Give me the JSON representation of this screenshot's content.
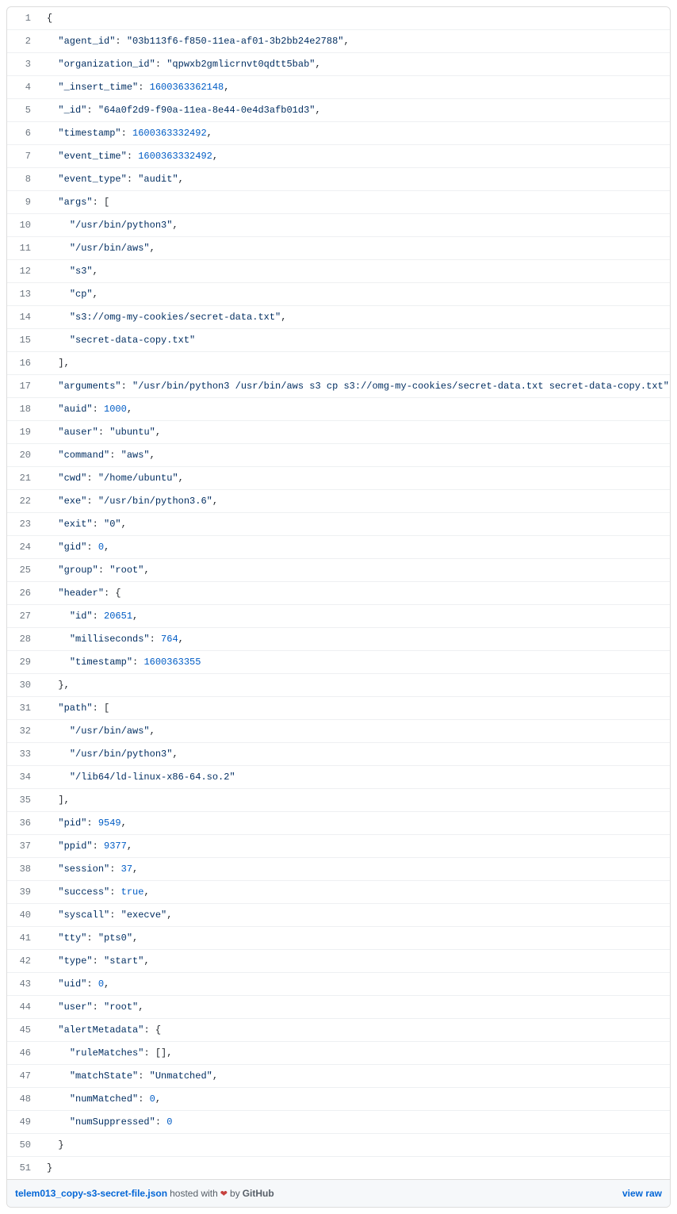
{
  "lines": [
    {
      "num": 1,
      "tokens": [
        {
          "t": "punct",
          "v": "{"
        }
      ],
      "indent": 0
    },
    {
      "num": 2,
      "tokens": [
        {
          "t": "key",
          "v": "\"agent_id\""
        },
        {
          "t": "punct",
          "v": ": "
        },
        {
          "t": "str",
          "v": "\"03b113f6-f850-11ea-af01-3b2bb24e2788\""
        },
        {
          "t": "punct",
          "v": ","
        }
      ],
      "indent": 1
    },
    {
      "num": 3,
      "tokens": [
        {
          "t": "key",
          "v": "\"organization_id\""
        },
        {
          "t": "punct",
          "v": ": "
        },
        {
          "t": "str",
          "v": "\"qpwxb2gmlicrnvt0qdtt5bab\""
        },
        {
          "t": "punct",
          "v": ","
        }
      ],
      "indent": 1
    },
    {
      "num": 4,
      "tokens": [
        {
          "t": "key",
          "v": "\"_insert_time\""
        },
        {
          "t": "punct",
          "v": ": "
        },
        {
          "t": "num",
          "v": "1600363362148"
        },
        {
          "t": "punct",
          "v": ","
        }
      ],
      "indent": 1
    },
    {
      "num": 5,
      "tokens": [
        {
          "t": "key",
          "v": "\"_id\""
        },
        {
          "t": "punct",
          "v": ": "
        },
        {
          "t": "str",
          "v": "\"64a0f2d9-f90a-11ea-8e44-0e4d3afb01d3\""
        },
        {
          "t": "punct",
          "v": ","
        }
      ],
      "indent": 1
    },
    {
      "num": 6,
      "tokens": [
        {
          "t": "key",
          "v": "\"timestamp\""
        },
        {
          "t": "punct",
          "v": ": "
        },
        {
          "t": "num",
          "v": "1600363332492"
        },
        {
          "t": "punct",
          "v": ","
        }
      ],
      "indent": 1
    },
    {
      "num": 7,
      "tokens": [
        {
          "t": "key",
          "v": "\"event_time\""
        },
        {
          "t": "punct",
          "v": ": "
        },
        {
          "t": "num",
          "v": "1600363332492"
        },
        {
          "t": "punct",
          "v": ","
        }
      ],
      "indent": 1
    },
    {
      "num": 8,
      "tokens": [
        {
          "t": "key",
          "v": "\"event_type\""
        },
        {
          "t": "punct",
          "v": ": "
        },
        {
          "t": "str",
          "v": "\"audit\""
        },
        {
          "t": "punct",
          "v": ","
        }
      ],
      "indent": 1
    },
    {
      "num": 9,
      "tokens": [
        {
          "t": "key",
          "v": "\"args\""
        },
        {
          "t": "punct",
          "v": ": ["
        }
      ],
      "indent": 1
    },
    {
      "num": 10,
      "tokens": [
        {
          "t": "str",
          "v": "\"/usr/bin/python3\""
        },
        {
          "t": "punct",
          "v": ","
        }
      ],
      "indent": 2
    },
    {
      "num": 11,
      "tokens": [
        {
          "t": "str",
          "v": "\"/usr/bin/aws\""
        },
        {
          "t": "punct",
          "v": ","
        }
      ],
      "indent": 2
    },
    {
      "num": 12,
      "tokens": [
        {
          "t": "str",
          "v": "\"s3\""
        },
        {
          "t": "punct",
          "v": ","
        }
      ],
      "indent": 2
    },
    {
      "num": 13,
      "tokens": [
        {
          "t": "str",
          "v": "\"cp\""
        },
        {
          "t": "punct",
          "v": ","
        }
      ],
      "indent": 2
    },
    {
      "num": 14,
      "tokens": [
        {
          "t": "str",
          "v": "\"s3://omg-my-cookies/secret-data.txt\""
        },
        {
          "t": "punct",
          "v": ","
        }
      ],
      "indent": 2
    },
    {
      "num": 15,
      "tokens": [
        {
          "t": "str",
          "v": "\"secret-data-copy.txt\""
        }
      ],
      "indent": 2
    },
    {
      "num": 16,
      "tokens": [
        {
          "t": "punct",
          "v": "],"
        }
      ],
      "indent": 1
    },
    {
      "num": 17,
      "tokens": [
        {
          "t": "key",
          "v": "\"arguments\""
        },
        {
          "t": "punct",
          "v": ": "
        },
        {
          "t": "str",
          "v": "\"/usr/bin/python3 /usr/bin/aws s3 cp s3://omg-my-cookies/secret-data.txt secret-data-copy.txt\""
        },
        {
          "t": "punct",
          "v": ","
        }
      ],
      "indent": 1
    },
    {
      "num": 18,
      "tokens": [
        {
          "t": "key",
          "v": "\"auid\""
        },
        {
          "t": "punct",
          "v": ": "
        },
        {
          "t": "num",
          "v": "1000"
        },
        {
          "t": "punct",
          "v": ","
        }
      ],
      "indent": 1
    },
    {
      "num": 19,
      "tokens": [
        {
          "t": "key",
          "v": "\"auser\""
        },
        {
          "t": "punct",
          "v": ": "
        },
        {
          "t": "str",
          "v": "\"ubuntu\""
        },
        {
          "t": "punct",
          "v": ","
        }
      ],
      "indent": 1
    },
    {
      "num": 20,
      "tokens": [
        {
          "t": "key",
          "v": "\"command\""
        },
        {
          "t": "punct",
          "v": ": "
        },
        {
          "t": "str",
          "v": "\"aws\""
        },
        {
          "t": "punct",
          "v": ","
        }
      ],
      "indent": 1
    },
    {
      "num": 21,
      "tokens": [
        {
          "t": "key",
          "v": "\"cwd\""
        },
        {
          "t": "punct",
          "v": ": "
        },
        {
          "t": "str",
          "v": "\"/home/ubuntu\""
        },
        {
          "t": "punct",
          "v": ","
        }
      ],
      "indent": 1
    },
    {
      "num": 22,
      "tokens": [
        {
          "t": "key",
          "v": "\"exe\""
        },
        {
          "t": "punct",
          "v": ": "
        },
        {
          "t": "str",
          "v": "\"/usr/bin/python3.6\""
        },
        {
          "t": "punct",
          "v": ","
        }
      ],
      "indent": 1
    },
    {
      "num": 23,
      "tokens": [
        {
          "t": "key",
          "v": "\"exit\""
        },
        {
          "t": "punct",
          "v": ": "
        },
        {
          "t": "str",
          "v": "\"0\""
        },
        {
          "t": "punct",
          "v": ","
        }
      ],
      "indent": 1
    },
    {
      "num": 24,
      "tokens": [
        {
          "t": "key",
          "v": "\"gid\""
        },
        {
          "t": "punct",
          "v": ": "
        },
        {
          "t": "num",
          "v": "0"
        },
        {
          "t": "punct",
          "v": ","
        }
      ],
      "indent": 1
    },
    {
      "num": 25,
      "tokens": [
        {
          "t": "key",
          "v": "\"group\""
        },
        {
          "t": "punct",
          "v": ": "
        },
        {
          "t": "str",
          "v": "\"root\""
        },
        {
          "t": "punct",
          "v": ","
        }
      ],
      "indent": 1
    },
    {
      "num": 26,
      "tokens": [
        {
          "t": "key",
          "v": "\"header\""
        },
        {
          "t": "punct",
          "v": ": {"
        }
      ],
      "indent": 1
    },
    {
      "num": 27,
      "tokens": [
        {
          "t": "key",
          "v": "\"id\""
        },
        {
          "t": "punct",
          "v": ": "
        },
        {
          "t": "num",
          "v": "20651"
        },
        {
          "t": "punct",
          "v": ","
        }
      ],
      "indent": 2
    },
    {
      "num": 28,
      "tokens": [
        {
          "t": "key",
          "v": "\"milliseconds\""
        },
        {
          "t": "punct",
          "v": ": "
        },
        {
          "t": "num",
          "v": "764"
        },
        {
          "t": "punct",
          "v": ","
        }
      ],
      "indent": 2
    },
    {
      "num": 29,
      "tokens": [
        {
          "t": "key",
          "v": "\"timestamp\""
        },
        {
          "t": "punct",
          "v": ": "
        },
        {
          "t": "num",
          "v": "1600363355"
        }
      ],
      "indent": 2
    },
    {
      "num": 30,
      "tokens": [
        {
          "t": "punct",
          "v": "},"
        }
      ],
      "indent": 1
    },
    {
      "num": 31,
      "tokens": [
        {
          "t": "key",
          "v": "\"path\""
        },
        {
          "t": "punct",
          "v": ": ["
        }
      ],
      "indent": 1
    },
    {
      "num": 32,
      "tokens": [
        {
          "t": "str",
          "v": "\"/usr/bin/aws\""
        },
        {
          "t": "punct",
          "v": ","
        }
      ],
      "indent": 2
    },
    {
      "num": 33,
      "tokens": [
        {
          "t": "str",
          "v": "\"/usr/bin/python3\""
        },
        {
          "t": "punct",
          "v": ","
        }
      ],
      "indent": 2
    },
    {
      "num": 34,
      "tokens": [
        {
          "t": "str",
          "v": "\"/lib64/ld-linux-x86-64.so.2\""
        }
      ],
      "indent": 2
    },
    {
      "num": 35,
      "tokens": [
        {
          "t": "punct",
          "v": "],"
        }
      ],
      "indent": 1
    },
    {
      "num": 36,
      "tokens": [
        {
          "t": "key",
          "v": "\"pid\""
        },
        {
          "t": "punct",
          "v": ": "
        },
        {
          "t": "num",
          "v": "9549"
        },
        {
          "t": "punct",
          "v": ","
        }
      ],
      "indent": 1
    },
    {
      "num": 37,
      "tokens": [
        {
          "t": "key",
          "v": "\"ppid\""
        },
        {
          "t": "punct",
          "v": ": "
        },
        {
          "t": "num",
          "v": "9377"
        },
        {
          "t": "punct",
          "v": ","
        }
      ],
      "indent": 1
    },
    {
      "num": 38,
      "tokens": [
        {
          "t": "key",
          "v": "\"session\""
        },
        {
          "t": "punct",
          "v": ": "
        },
        {
          "t": "num",
          "v": "37"
        },
        {
          "t": "punct",
          "v": ","
        }
      ],
      "indent": 1
    },
    {
      "num": 39,
      "tokens": [
        {
          "t": "key",
          "v": "\"success\""
        },
        {
          "t": "punct",
          "v": ": "
        },
        {
          "t": "bool",
          "v": "true"
        },
        {
          "t": "punct",
          "v": ","
        }
      ],
      "indent": 1
    },
    {
      "num": 40,
      "tokens": [
        {
          "t": "key",
          "v": "\"syscall\""
        },
        {
          "t": "punct",
          "v": ": "
        },
        {
          "t": "str",
          "v": "\"execve\""
        },
        {
          "t": "punct",
          "v": ","
        }
      ],
      "indent": 1
    },
    {
      "num": 41,
      "tokens": [
        {
          "t": "key",
          "v": "\"tty\""
        },
        {
          "t": "punct",
          "v": ": "
        },
        {
          "t": "str",
          "v": "\"pts0\""
        },
        {
          "t": "punct",
          "v": ","
        }
      ],
      "indent": 1
    },
    {
      "num": 42,
      "tokens": [
        {
          "t": "key",
          "v": "\"type\""
        },
        {
          "t": "punct",
          "v": ": "
        },
        {
          "t": "str",
          "v": "\"start\""
        },
        {
          "t": "punct",
          "v": ","
        }
      ],
      "indent": 1
    },
    {
      "num": 43,
      "tokens": [
        {
          "t": "key",
          "v": "\"uid\""
        },
        {
          "t": "punct",
          "v": ": "
        },
        {
          "t": "num",
          "v": "0"
        },
        {
          "t": "punct",
          "v": ","
        }
      ],
      "indent": 1
    },
    {
      "num": 44,
      "tokens": [
        {
          "t": "key",
          "v": "\"user\""
        },
        {
          "t": "punct",
          "v": ": "
        },
        {
          "t": "str",
          "v": "\"root\""
        },
        {
          "t": "punct",
          "v": ","
        }
      ],
      "indent": 1
    },
    {
      "num": 45,
      "tokens": [
        {
          "t": "key",
          "v": "\"alertMetadata\""
        },
        {
          "t": "punct",
          "v": ": {"
        }
      ],
      "indent": 1
    },
    {
      "num": 46,
      "tokens": [
        {
          "t": "key",
          "v": "\"ruleMatches\""
        },
        {
          "t": "punct",
          "v": ": [],"
        }
      ],
      "indent": 2
    },
    {
      "num": 47,
      "tokens": [
        {
          "t": "key",
          "v": "\"matchState\""
        },
        {
          "t": "punct",
          "v": ": "
        },
        {
          "t": "str",
          "v": "\"Unmatched\""
        },
        {
          "t": "punct",
          "v": ","
        }
      ],
      "indent": 2
    },
    {
      "num": 48,
      "tokens": [
        {
          "t": "key",
          "v": "\"numMatched\""
        },
        {
          "t": "punct",
          "v": ": "
        },
        {
          "t": "num",
          "v": "0"
        },
        {
          "t": "punct",
          "v": ","
        }
      ],
      "indent": 2
    },
    {
      "num": 49,
      "tokens": [
        {
          "t": "key",
          "v": "\"numSuppressed\""
        },
        {
          "t": "punct",
          "v": ": "
        },
        {
          "t": "num",
          "v": "0"
        }
      ],
      "indent": 2
    },
    {
      "num": 50,
      "tokens": [
        {
          "t": "punct",
          "v": "}"
        }
      ],
      "indent": 1
    },
    {
      "num": 51,
      "tokens": [
        {
          "t": "punct",
          "v": "}"
        }
      ],
      "indent": 0
    }
  ],
  "meta": {
    "filename": "telem013_copy-s3-secret-file.json",
    "hosted_with": "hosted with",
    "by": "by",
    "github": "GitHub",
    "view_raw": "view raw"
  }
}
